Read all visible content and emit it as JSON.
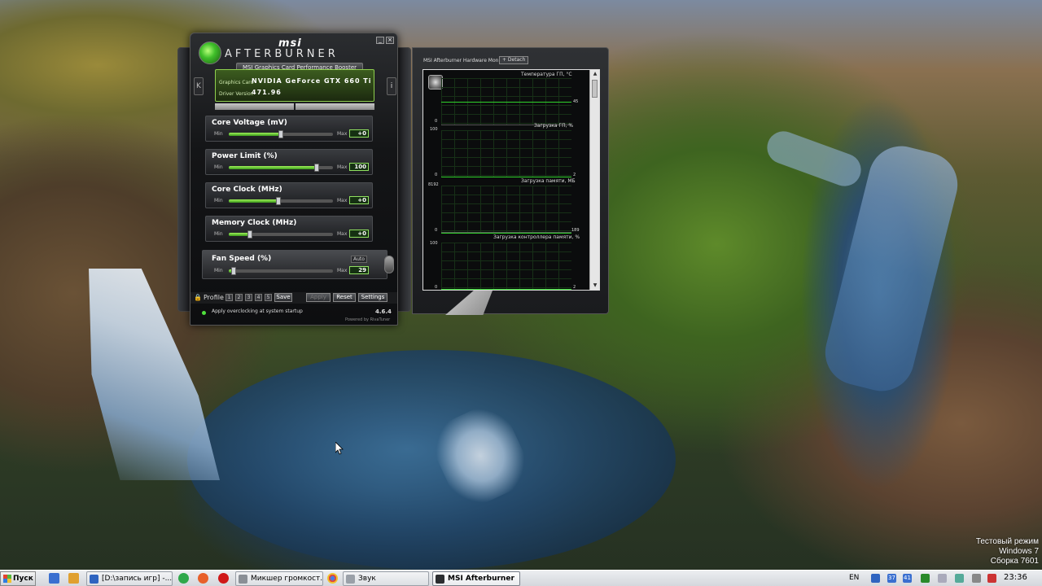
{
  "afterburner": {
    "brand": "msi",
    "product": "AFTERBURNER",
    "tagline": "MSI Graphics Card Performance Booster",
    "graphics_card_label": "Graphics Card",
    "graphics_card_value": "NVIDIA GeForce GTX 660 Ti",
    "driver_label": "Driver Version",
    "driver_value": "471.96",
    "nav_left": "K",
    "nav_info": "i",
    "min_label": "Min",
    "max_label": "Max",
    "auto_label": "Auto",
    "sliders": [
      {
        "title": "Core Voltage (mV)",
        "value": "+0",
        "fill": 0.5
      },
      {
        "title": "Power Limit (%)",
        "value": "100",
        "fill": 0.84
      },
      {
        "title": "Core Clock (MHz)",
        "value": "+0",
        "fill": 0.48
      },
      {
        "title": "Memory Clock (MHz)",
        "value": "+0",
        "fill": 0.2
      },
      {
        "title": "Fan Speed (%)",
        "value": "29",
        "fill": 0.05
      }
    ],
    "profile_label": "Profile",
    "profile_slots": [
      "1",
      "2",
      "3",
      "4",
      "5"
    ],
    "save_label": "Save",
    "apply_label": "Apply",
    "reset_label": "Reset",
    "settings_label": "Settings",
    "startup_text": "Apply overclocking at system startup",
    "version": "4.6.4",
    "powered": "Powered by RivaTuner"
  },
  "monitor": {
    "title": "MSI Afterburner Hardware Monitor",
    "detach_label": "+ Detach",
    "graphs": [
      {
        "label": "Температура ГП, °C",
        "top_tick": "",
        "bottom_tick": "0",
        "current": "45"
      },
      {
        "label": "Загрузка ГП, %",
        "top_tick": "100",
        "bottom_tick": "0",
        "current": "2"
      },
      {
        "label": "Загрузка памяти, МБ",
        "top_tick": "8192",
        "bottom_tick": "0",
        "current": "189"
      },
      {
        "label": "Загрузка контроллера памяти, %",
        "top_tick": "100",
        "bottom_tick": "0",
        "current": "2"
      }
    ]
  },
  "watermark": {
    "line1": "Тестовый режим",
    "line2": "Windows 7",
    "line3": "Сборка 7601"
  },
  "taskbar": {
    "start_label": "Пуск",
    "tasks": [
      {
        "label": "[D:\\запись игр] -..."
      },
      {
        "label": "Микшер громкост..."
      },
      {
        "label": "Звук"
      },
      {
        "label": "MSI Afterburner"
      }
    ],
    "language": "EN",
    "tray_nums": [
      "37",
      "41"
    ],
    "clock": "23:36"
  },
  "colors": {
    "accent_green": "#2fd22a",
    "taskbar": "#d4d7dc"
  }
}
